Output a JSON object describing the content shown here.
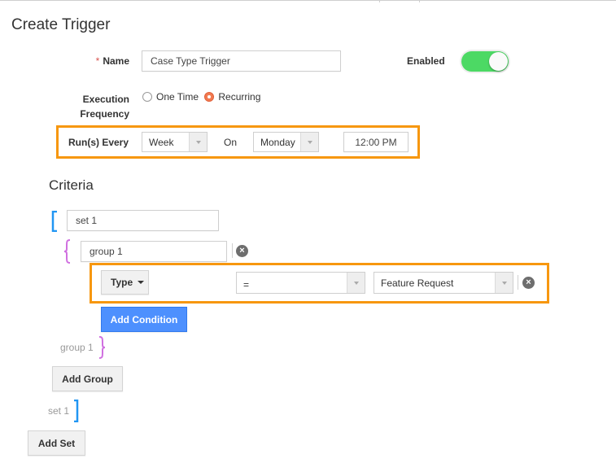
{
  "page": {
    "title": "Create Trigger"
  },
  "form": {
    "name": {
      "label": "Name",
      "required_mark": "*",
      "value": "Case Type Trigger"
    },
    "enabled": {
      "label": "Enabled",
      "on": true,
      "color": "#4cd964"
    },
    "execution_frequency": {
      "label_line1": "Execution",
      "label_line2": "Frequency",
      "options": [
        {
          "label": "One Time",
          "selected": false
        },
        {
          "label": "Recurring",
          "selected": true
        }
      ]
    },
    "runs_every": {
      "label": "Run(s) Every",
      "interval": "Week",
      "on_label": "On",
      "day": "Monday",
      "time": "12:00 PM"
    }
  },
  "criteria": {
    "heading": "Criteria",
    "sets": [
      {
        "name": "set 1",
        "close_label": "set 1",
        "groups": [
          {
            "name": "group 1",
            "close_label": "group 1",
            "conditions": [
              {
                "field": "Type",
                "operator": "=",
                "value": "Feature Request"
              }
            ]
          }
        ]
      }
    ],
    "buttons": {
      "add_condition": "Add Condition",
      "add_group": "Add Group",
      "add_set": "Add Set"
    },
    "remove_icon": "×"
  },
  "colors": {
    "highlight": "#f7970f",
    "set_bracket": "#2196f3",
    "group_bracket": "#d070e0",
    "primary_button": "#4d90fe"
  }
}
